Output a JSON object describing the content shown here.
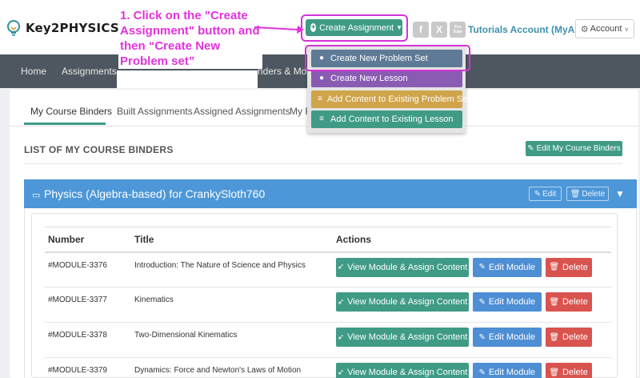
{
  "header": {
    "logo_text": "Key2PHYSICS",
    "annotation": "1. Click on the \"Create Assignment\" button and then “Create New Problem set”",
    "create_button_label": "Create Assignment",
    "social": [
      "f",
      "X",
      "You Tube"
    ],
    "tutorials_link": "Tutorials Account (MyAlias)",
    "account_label": "Account"
  },
  "nav": {
    "items": [
      "Home",
      "Assignments",
      "nders & Modu"
    ]
  },
  "dropdown": {
    "items": [
      {
        "label": "Create New Problem Set",
        "color": "#5f7a96"
      },
      {
        "label": "Create New Lesson",
        "color": "#8a5bb3"
      },
      {
        "label": "Add Content to Existing Problem Set",
        "color": "#d0a44a"
      },
      {
        "label": "Add Content to Existing Lesson",
        "color": "#3f9b86"
      }
    ]
  },
  "tabs": [
    "My Course Binders",
    "Built Assignments",
    "Assigned Assignments",
    "My P"
  ],
  "list_title": "LIST OF MY COURSE BINDERS",
  "edit_binders_label": "Edit My Course Binders",
  "binder": {
    "title": "Physics (Algebra-based) for CrankySloth760",
    "edit_label": "Edit",
    "delete_label": "Delete"
  },
  "table": {
    "headers": [
      "Number",
      "Title",
      "Actions"
    ],
    "rows": [
      {
        "number": "#MODULE-3376",
        "title": "Introduction: The Nature of Science and Physics"
      },
      {
        "number": "#MODULE-3377",
        "title": "Kinematics"
      },
      {
        "number": "#MODULE-3378",
        "title": "Two-Dimensional Kinematics"
      },
      {
        "number": "#MODULE-3379",
        "title": "Dynamics: Force and Newton's Laws of Motion"
      }
    ],
    "actions": {
      "view": "View Module & Assign Content",
      "edit": "Edit Module",
      "delete": "Delete"
    }
  },
  "colors": {
    "accent": "#3f9b86",
    "nav_bg": "#4e5760",
    "binder_header": "#4d97d8",
    "danger": "#d9534f",
    "annotation": "#e232dc"
  }
}
